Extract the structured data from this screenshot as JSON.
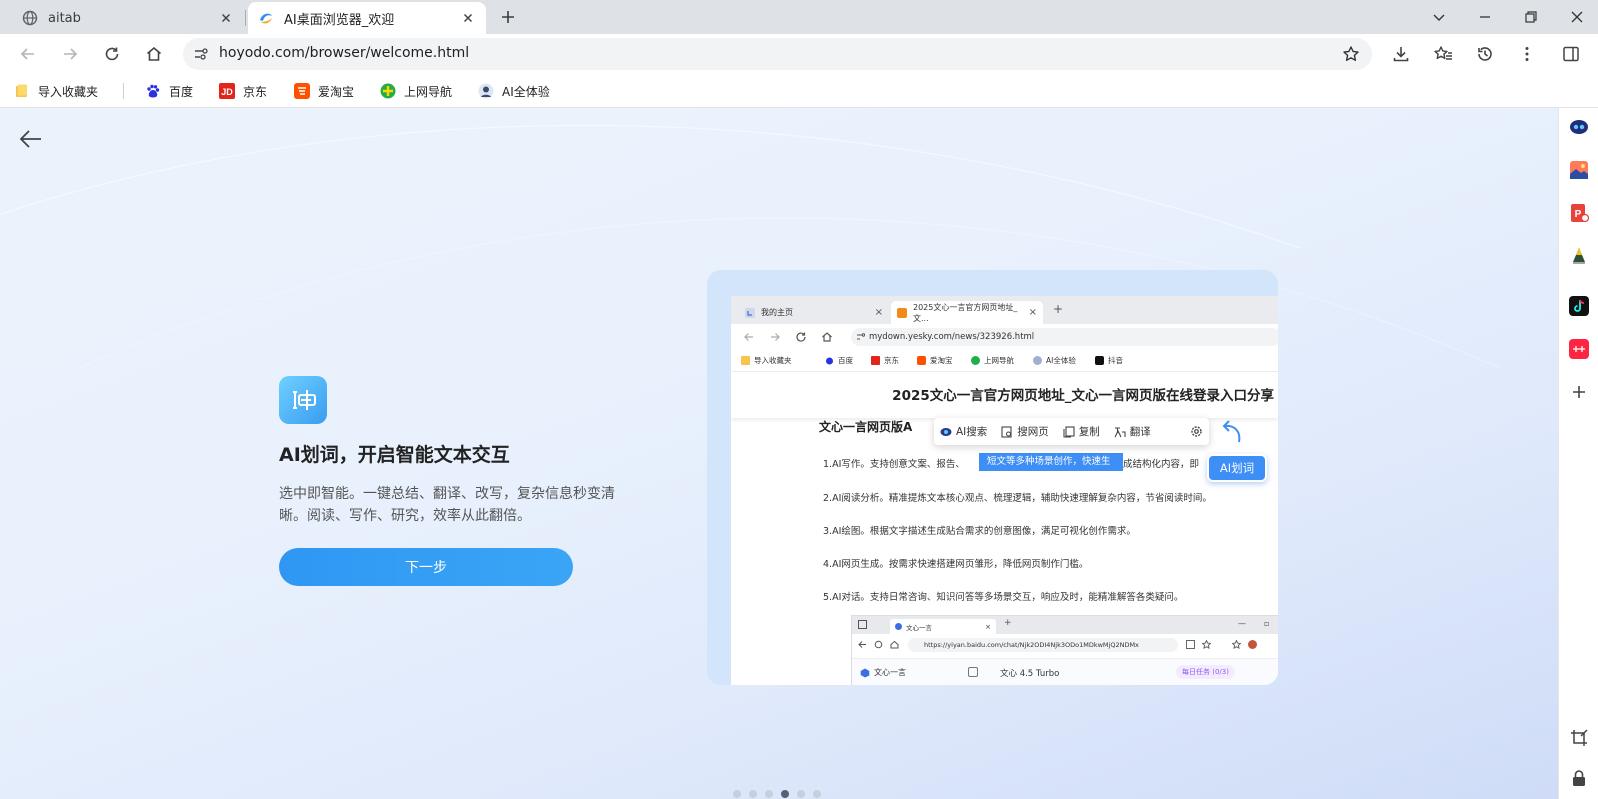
{
  "browser": {
    "tabs": [
      {
        "title": "aitab",
        "icon": "globe-icon"
      },
      {
        "title": "AI桌面浏览器_欢迎",
        "icon": "hoyodo-browser-icon",
        "active": true
      }
    ],
    "address": "hoyodo.com/browser/welcome.html",
    "bookmarks": [
      {
        "label": "导入收藏夹",
        "icon": "folder-icon"
      },
      {
        "label": "百度",
        "icon": "baidu-icon"
      },
      {
        "label": "京东",
        "icon": "jd-icon"
      },
      {
        "label": "爱淘宝",
        "icon": "taobao-icon"
      },
      {
        "label": "上网导航",
        "icon": "navigation-icon"
      },
      {
        "label": "AI全体验",
        "icon": "ai-avatar-icon"
      }
    ]
  },
  "welcome": {
    "feature_title": "AI划词，开启智能文本交互",
    "feature_desc": "选中即智能。一键总结、翻译、改写，复杂信息秒变清晰。阅读、写作、研究，效率从此翻倍。",
    "next_button": "下一步",
    "page_dots_total": 6,
    "page_dots_active": 4
  },
  "preview": {
    "tabs": [
      {
        "title": "我的主页"
      },
      {
        "title": "2025文心一言官方网页地址_文..."
      }
    ],
    "address": "mydown.yesky.com/news/323926.html",
    "bookmarks": [
      "导入收藏夹",
      "百度",
      "京东",
      "爱淘宝",
      "上网导航",
      "AI全体验",
      "抖音"
    ],
    "article_title": "2025文心一言官方网页地址_文心一言网页版在线登录入口分享",
    "section_title": "文心一言网页版A",
    "paragraphs": [
      "1.AI写作。支持创意文案、报告、",
      "2.AI阅读分析。精准提炼文本核心观点、梳理逻辑，辅助快速理解复杂内容，节省阅读时间。",
      "3.AI绘图。根据文字描述生成贴合需求的创意图像，满足可视化创作需求。",
      "4.AI网页生成。按需求快速搭建网页雏形，降低网页制作门槛。",
      "5.AI对话。支持日常咨询、知识问答等多场景交互，响应及时，能精准解答各类疑问。"
    ],
    "para1_tail": "成结构化内容，即",
    "highlight": "短文等多种场景创作，快速生",
    "menu": [
      "AI搜索",
      "搜网页",
      "复制",
      "翻译"
    ],
    "ai_tag": "AI划词",
    "screenshot": {
      "tab": "文心一言",
      "url": "https://yiyan.baidu.com/chat/Njk2ODI4Njk3ODo1MDkwMjQ2NDMx",
      "app": "文心一言",
      "model": "文心 4.5 Turbo",
      "task": "每日任务 (0/3)"
    }
  }
}
